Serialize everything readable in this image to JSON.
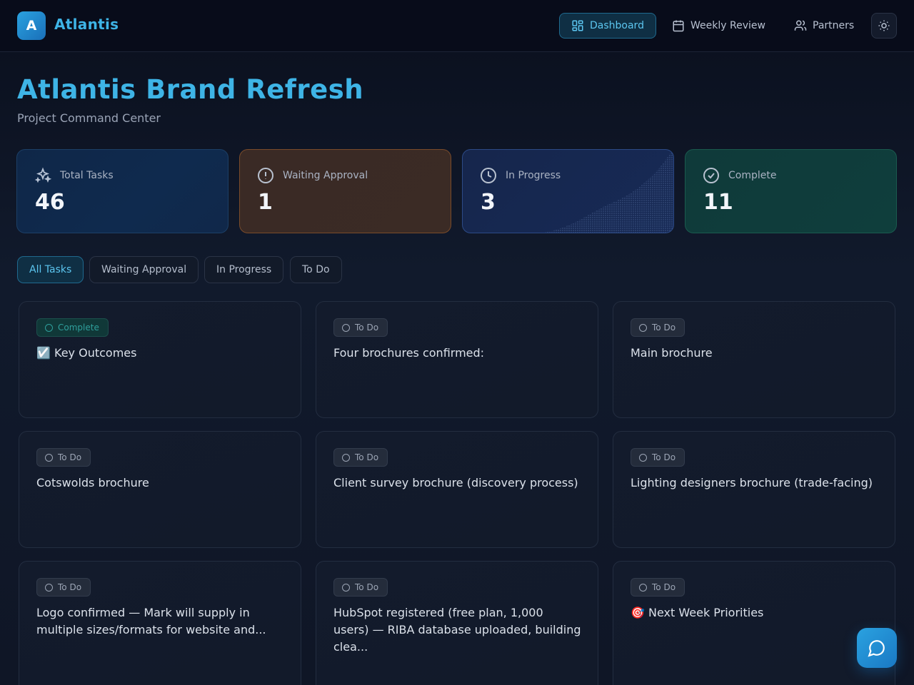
{
  "header": {
    "logo_letter": "A",
    "brand": "Atlantis",
    "nav": {
      "dashboard": "Dashboard",
      "weekly_review": "Weekly Review",
      "partners": "Partners"
    }
  },
  "page": {
    "title": "Atlantis Brand Refresh",
    "subtitle": "Project Command Center"
  },
  "stats": {
    "total": {
      "label": "Total Tasks",
      "value": "46"
    },
    "waiting": {
      "label": "Waiting Approval",
      "value": "1"
    },
    "in_progress": {
      "label": "In Progress",
      "value": "3"
    },
    "complete": {
      "label": "Complete",
      "value": "11"
    }
  },
  "filters": {
    "all": "All Tasks",
    "waiting": "Waiting Approval",
    "in_progress": "In Progress",
    "todo": "To Do"
  },
  "tasks": [
    {
      "status": "Complete",
      "title": "☑️ Key Outcomes"
    },
    {
      "status": "To Do",
      "title": "Four brochures confirmed:"
    },
    {
      "status": "To Do",
      "title": "Main brochure"
    },
    {
      "status": "To Do",
      "title": "Cotswolds brochure"
    },
    {
      "status": "To Do",
      "title": "Client survey brochure (discovery process)"
    },
    {
      "status": "To Do",
      "title": "Lighting designers brochure (trade-facing)"
    },
    {
      "status": "To Do",
      "title": "Logo confirmed — Mark will supply in multiple sizes/formats for website and..."
    },
    {
      "status": "To Do",
      "title": "HubSpot registered (free plan, 1,000 users) — RIBA database uploaded, building clea..."
    },
    {
      "status": "To Do",
      "title": "🎯 Next Week Priorities"
    }
  ],
  "colors": {
    "accent": "#3eb4e6",
    "background": "#0d1322",
    "complete": "#2f9f9c"
  }
}
